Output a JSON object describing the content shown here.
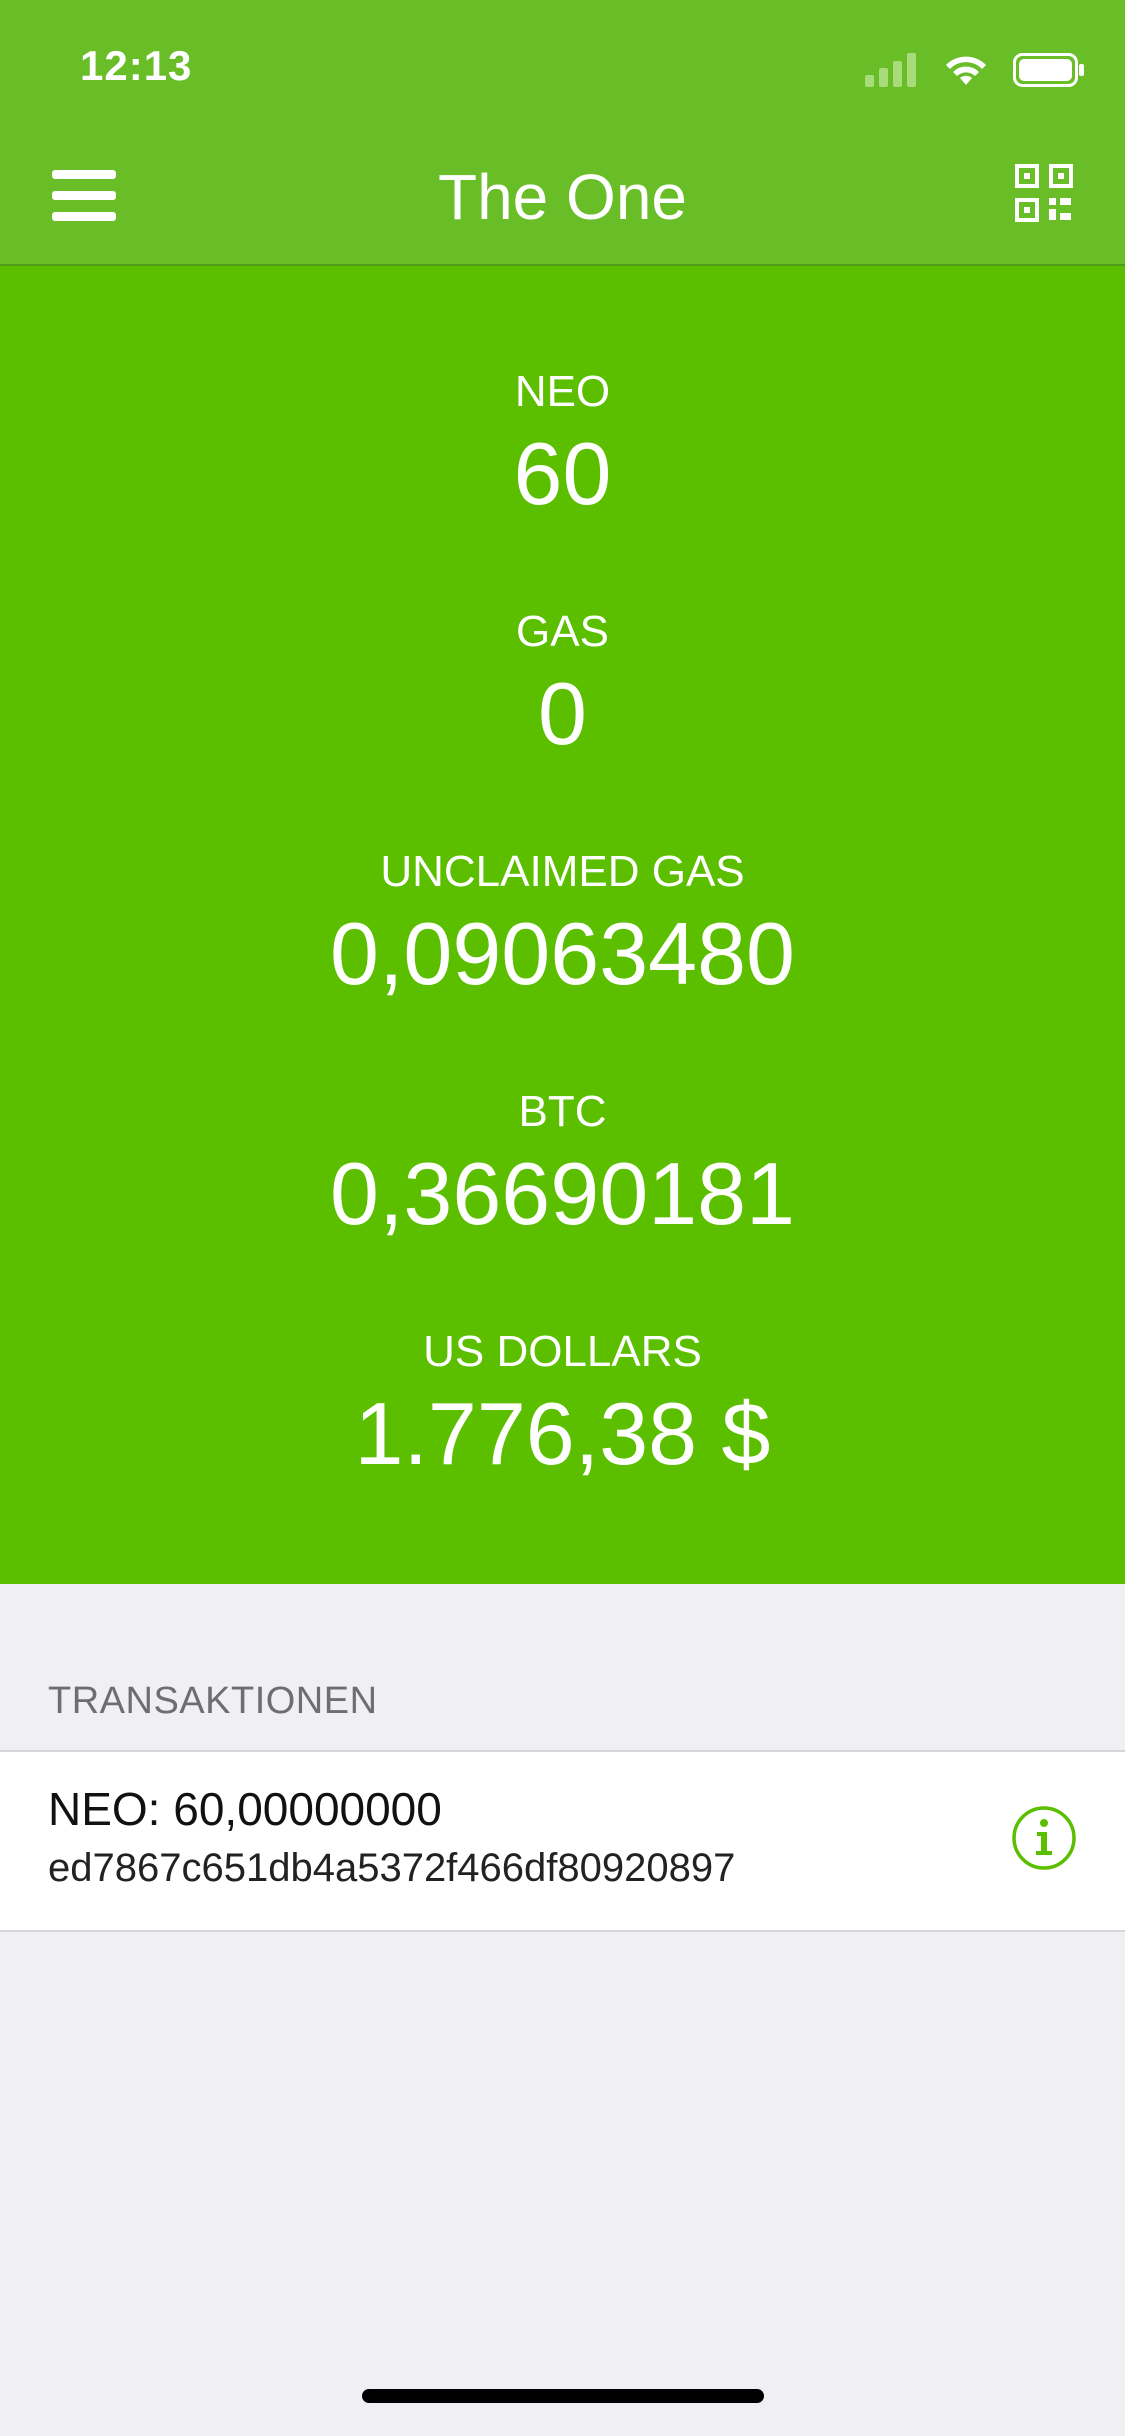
{
  "status": {
    "time": "12:13"
  },
  "nav": {
    "title": "The One"
  },
  "balances": [
    {
      "label": "NEO",
      "value": "60"
    },
    {
      "label": "GAS",
      "value": "0"
    },
    {
      "label": "UNCLAIMED GAS",
      "value": "0,09063480"
    },
    {
      "label": "BTC",
      "value": "0,36690181"
    },
    {
      "label": "US DOLLARS",
      "value": "1.776,38 $"
    }
  ],
  "transactions": {
    "header": "TRANSAKTIONEN",
    "items": [
      {
        "amount": "NEO: 60,00000000",
        "hash": "ed7867c651db4a5372f466df80920897"
      }
    ]
  },
  "colors": {
    "nav_green": "#69be28",
    "panel_green": "#5bbf00",
    "background": "#efeff4"
  },
  "icons": [
    "signal-icon",
    "wifi-icon",
    "battery-icon",
    "menu-icon",
    "qr-code-icon",
    "info-icon"
  ]
}
